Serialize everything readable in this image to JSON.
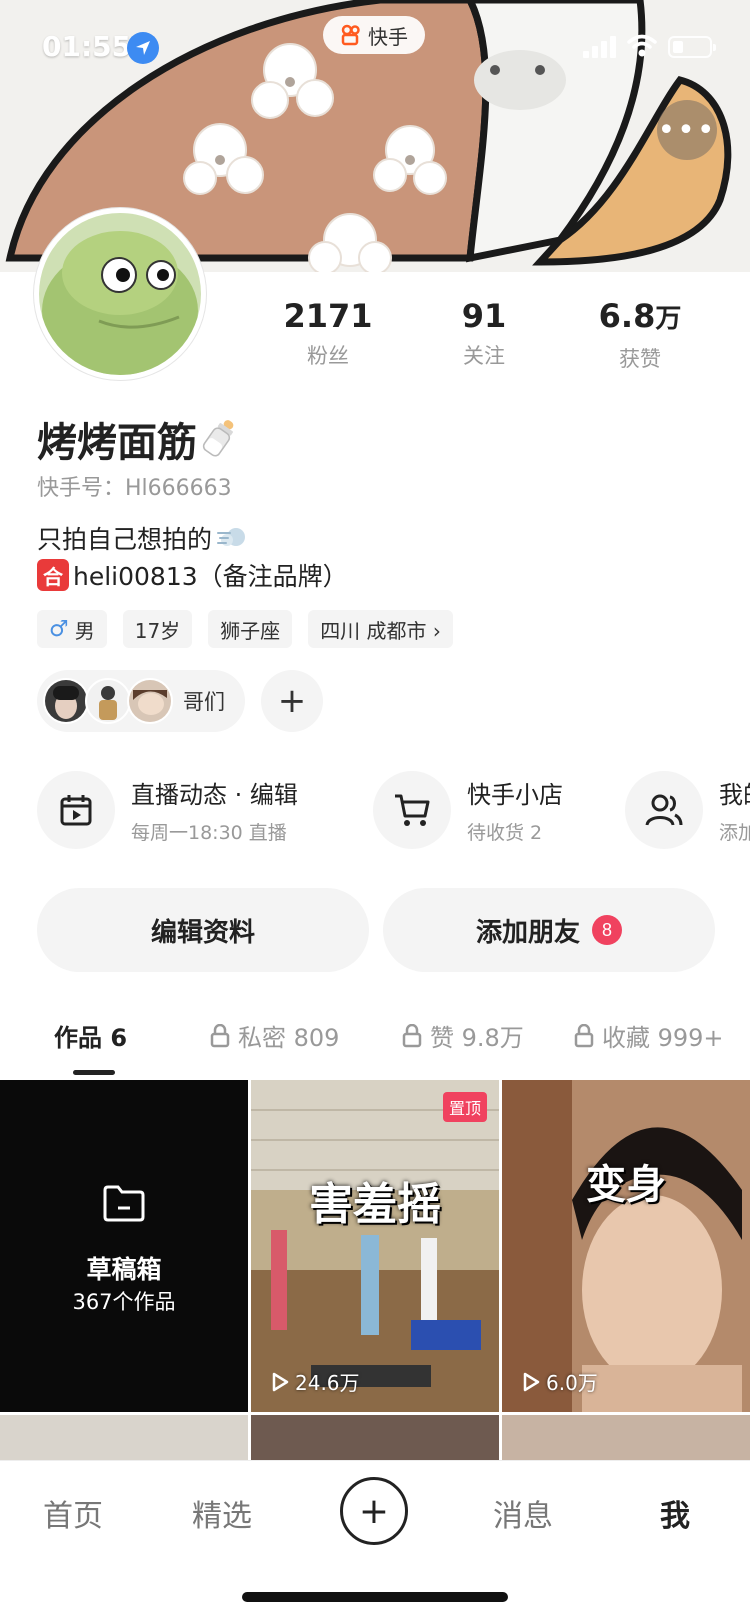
{
  "status_bar": {
    "time": "01:55",
    "app_pill": "快手"
  },
  "profile": {
    "stats": [
      {
        "value": "2171",
        "unit": "",
        "label": "粉丝"
      },
      {
        "value": "91",
        "unit": "",
        "label": "关注"
      },
      {
        "value": "6.8",
        "unit": "万",
        "label": "获赞"
      }
    ],
    "nickname": "烤烤面筋",
    "kuaishou_id": "快手号：Hl666663",
    "bio_line1": "只拍自己想拍的",
    "bio_line2_icon": "合",
    "bio_line2": "heli00813（备注品牌）",
    "tags": [
      {
        "icon": "♂",
        "label": "男"
      },
      {
        "icon": "",
        "label": "17岁"
      },
      {
        "icon": "",
        "label": "狮子座"
      },
      {
        "icon": "",
        "label": "四川 成都市 ›"
      }
    ],
    "friends_label": "哥们",
    "add_label": "+"
  },
  "features": [
    {
      "title": "直播动态 · 编辑",
      "sub": "每周一18:30 直播",
      "icon": "calendar-icon"
    },
    {
      "title": "快手小店",
      "sub": "待收货 2",
      "icon": "cart-icon"
    },
    {
      "title": "我的",
      "sub": "添加",
      "icon": "people-icon"
    }
  ],
  "buttons": {
    "edit_profile": "编辑资料",
    "add_friend": "添加朋友",
    "add_friend_badge": "8"
  },
  "tabs": [
    {
      "label": "作品 6",
      "locked": false
    },
    {
      "label": "私密 809",
      "locked": true
    },
    {
      "label": "赞 9.8万",
      "locked": true
    },
    {
      "label": "收藏 999+",
      "locked": true
    }
  ],
  "grid": {
    "draft_title": "草稿箱",
    "draft_count": "367个作品",
    "video1_caption": "害羞摇",
    "video1_pinned": "置顶",
    "video1_views": "24.6万",
    "video2_caption": "变身",
    "video2_views": "6.0万"
  },
  "bottom_nav": {
    "home": "首页",
    "featured": "精选",
    "plus": "+",
    "messages": "消息",
    "me": "我"
  }
}
